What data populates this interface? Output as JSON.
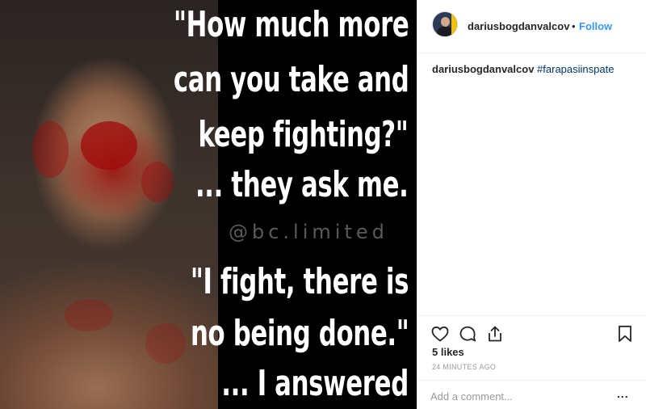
{
  "post": {
    "image": {
      "quote_lines": [
        "\"How much more",
        "can you take and",
        "keep fighting?\"",
        "... they ask me.",
        "\"I fight, there is",
        "no being done.\"",
        "... I answered"
      ],
      "watermark": "@bc.limited"
    },
    "header": {
      "username": "dariusbogdanvalcov",
      "separator": "•",
      "follow_label": "Follow"
    },
    "caption": {
      "username": "dariusbogdanvalcov",
      "hashtag": "#farapasiinspate"
    },
    "actions": {
      "like_icon": "heart-icon",
      "comment_icon": "comment-icon",
      "share_icon": "share-icon",
      "save_icon": "bookmark-icon"
    },
    "likes_text": "5 likes",
    "timestamp": "24 MINUTES AGO",
    "comment": {
      "placeholder": "Add a comment...",
      "more_label": "..."
    },
    "colors": {
      "follow": "#3897f0",
      "hashtag": "#003569",
      "text": "#262626",
      "muted": "#999999"
    }
  }
}
